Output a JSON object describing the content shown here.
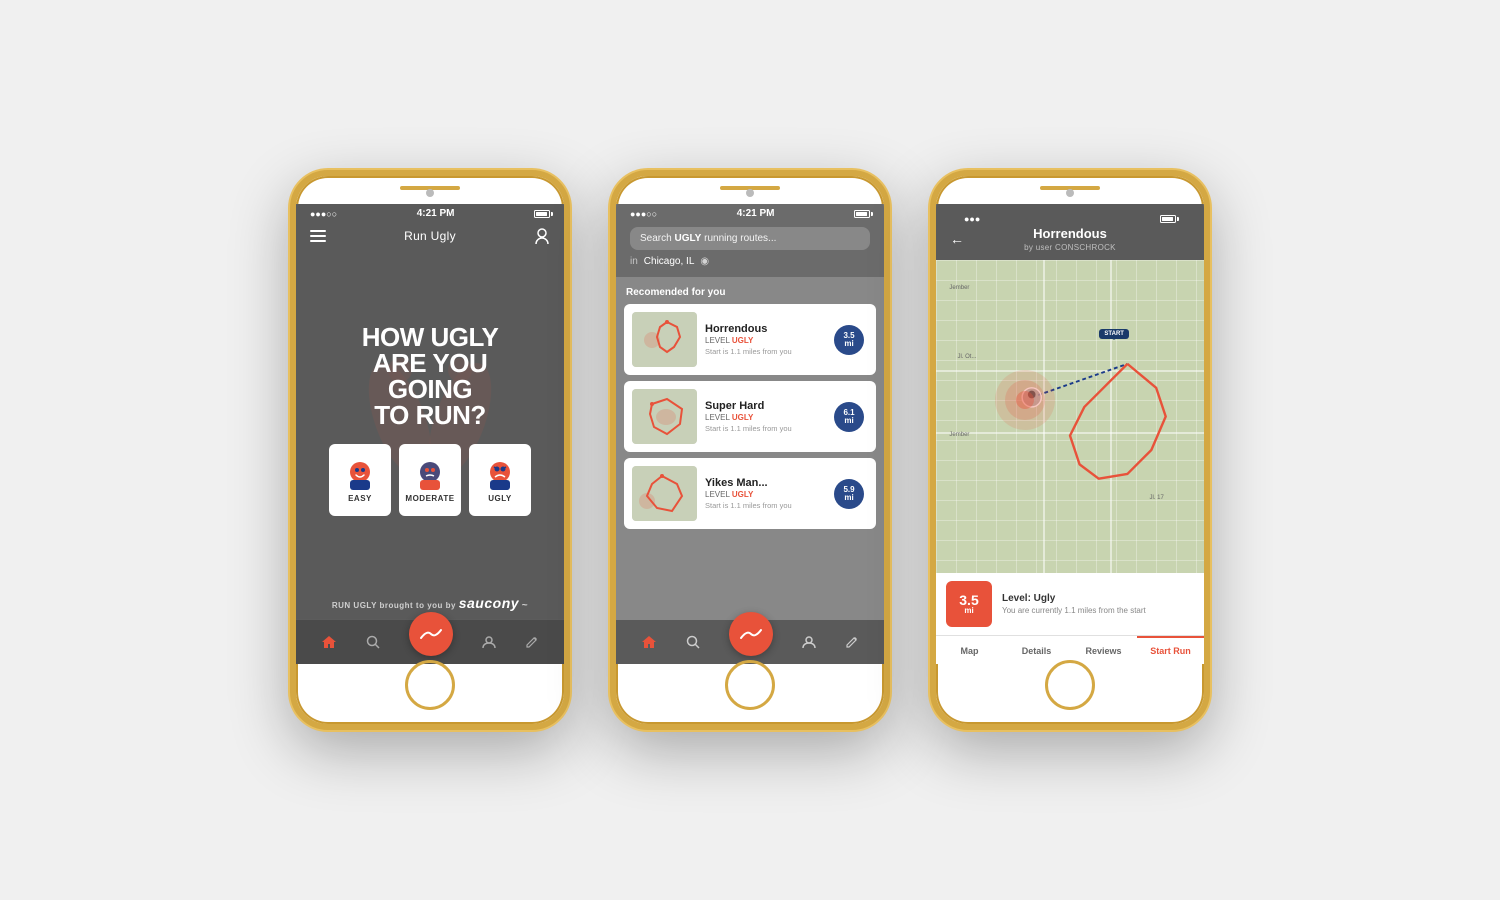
{
  "phone1": {
    "status": {
      "signal": "●●●○○",
      "time": "4:21 PM",
      "battery": "full"
    },
    "nav": {
      "title": "Run Ugly"
    },
    "hero": {
      "headline_line1": "HOW UGLY",
      "headline_line2": "ARE YOU",
      "headline_line3": "GOING",
      "headline_line4": "TO RUN?"
    },
    "difficulties": [
      {
        "label": "EASY",
        "id": "easy"
      },
      {
        "label": "MODERATE",
        "id": "moderate"
      },
      {
        "label": "UGLY",
        "id": "ugly"
      }
    ],
    "brand": {
      "prefix": "RUN UGLY",
      "mid": "brought to you by",
      "name": "saucony"
    },
    "tabs": [
      {
        "id": "home",
        "icon": "🏠",
        "active": true
      },
      {
        "id": "search",
        "icon": "🔍",
        "active": false
      },
      {
        "id": "logo",
        "center": true
      },
      {
        "id": "profile",
        "icon": "👤",
        "active": false
      },
      {
        "id": "edit",
        "icon": "✏️",
        "active": false
      }
    ]
  },
  "phone2": {
    "status": {
      "signal": "●●●○○",
      "time": "4:21 PM"
    },
    "search": {
      "placeholder": "Search UGLY running routes...",
      "placeholder_bold": "UGLY",
      "location_label": "in",
      "location": "Chicago, IL"
    },
    "section_title": "Recomended for you",
    "routes": [
      {
        "name": "Horrendous",
        "level": "UGLY",
        "distance": "3.5",
        "unit": "mi",
        "start_info": "Start is 1.1 miles from you"
      },
      {
        "name": "Super Hard",
        "level": "UGLY",
        "distance": "6.1",
        "unit": "mi",
        "start_info": "Start is 1.1 miles from you"
      },
      {
        "name": "Yikes Man...",
        "level": "UGLY",
        "distance": "5.9",
        "unit": "mi",
        "start_info": "Start is 1.1 miles from you"
      }
    ]
  },
  "phone3": {
    "status": {},
    "header": {
      "title": "Horrendous",
      "subtitle": "by user CONSCHROCK"
    },
    "map": {
      "start_label": "START"
    },
    "info": {
      "distance": "3.5",
      "unit": "mi",
      "level": "Level: Ugly",
      "description": "You are currently 1.1 miles from the start"
    },
    "tabs": [
      {
        "label": "Map",
        "active": true
      },
      {
        "label": "Details",
        "active": false
      },
      {
        "label": "Reviews",
        "active": false
      },
      {
        "label": "Start Run",
        "active": false,
        "highlight": true
      }
    ]
  }
}
